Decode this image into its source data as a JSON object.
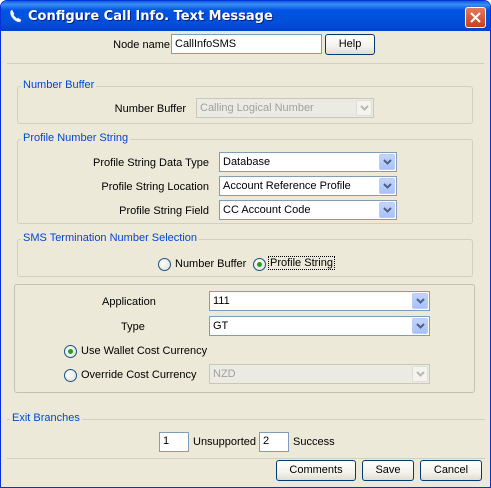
{
  "window": {
    "title": "Configure Call Info. Text Message"
  },
  "header": {
    "node_name_label": "Node name",
    "node_name_value": "CallInfoSMS",
    "help_label": "Help"
  },
  "number_buffer": {
    "legend": "Number Buffer",
    "label": "Number Buffer",
    "value": "Calling Logical Number"
  },
  "profile_number_string": {
    "legend": "Profile Number String",
    "data_type_label": "Profile String Data Type",
    "data_type_value": "Database",
    "location_label": "Profile String Location",
    "location_value": "Account Reference Profile",
    "field_label": "Profile String Field",
    "field_value": "CC Account Code"
  },
  "sms_termination": {
    "legend": "SMS Termination Number Selection",
    "option_number_buffer": "Number Buffer",
    "option_profile_string": "Profile String",
    "selected": "Profile String"
  },
  "cost": {
    "application_label": "Application",
    "application_value": "111",
    "type_label": "Type",
    "type_value": "GT",
    "use_wallet_label": "Use Wallet Cost Currency",
    "override_label": "Override Cost Currency",
    "override_value": "NZD",
    "selected": "Use Wallet Cost Currency"
  },
  "exit_branches": {
    "legend": "Exit Branches",
    "branches": [
      {
        "number": "1",
        "name": "Unsupported"
      },
      {
        "number": "2",
        "name": "Success"
      }
    ]
  },
  "footer": {
    "comments_label": "Comments",
    "save_label": "Save",
    "cancel_label": "Cancel"
  },
  "colors": {
    "title_bar": "#0054e3",
    "legend_text": "#0046d5",
    "window_bg": "#ece9d8",
    "radio_selected": "#21a121"
  }
}
